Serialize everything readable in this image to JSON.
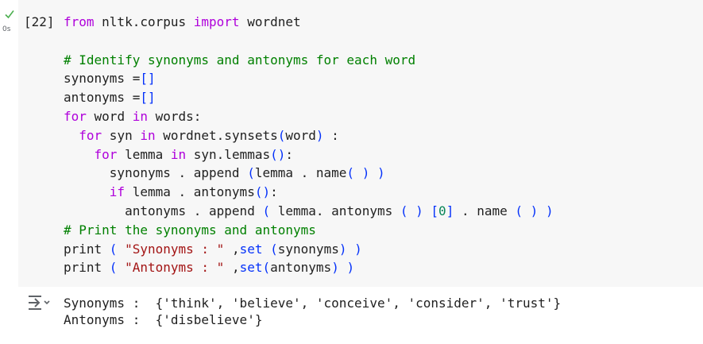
{
  "cell": {
    "execution_count": "[22]",
    "execution_time": "0s",
    "status": "success"
  },
  "code": {
    "line1": {
      "kw1": "from",
      "mod": " nltk.corpus ",
      "kw2": "import",
      "rest": " wordnet"
    },
    "line3": {
      "comment": "# Identify synonyms and antonyms for each word"
    },
    "line4": {
      "a": "synonyms =",
      "b": "[]"
    },
    "line5": {
      "a": "antonyms =",
      "b": "[]"
    },
    "line6": {
      "kw1": "for",
      "a": " word ",
      "kw2": "in",
      "b": " words:"
    },
    "line7": {
      "indent": "  ",
      "kw1": "for",
      "a": " syn ",
      "kw2": "in",
      "b": " wordnet.synsets",
      "p1": "(",
      "c": "word",
      "p2": ")",
      "d": " :"
    },
    "line8": {
      "indent": "    ",
      "kw1": "for",
      "a": " lemma ",
      "kw2": "in",
      "b": " syn.lemmas",
      "p1": "()",
      "c": ":"
    },
    "line9": {
      "indent": "      ",
      "a": "synonyms . append ",
      "p1": "(",
      "b": "lemma . name",
      "p2": "( )",
      "c": " ",
      "p3": ")"
    },
    "line10": {
      "indent": "      ",
      "kw1": "if",
      "a": " lemma . antonyms",
      "p1": "()",
      "b": ":"
    },
    "line11": {
      "indent": "        ",
      "a": "antonyms . append ",
      "p1": "(",
      "b": " lemma. antonyms ",
      "p2": "( )",
      "c": " ",
      "p3": "[",
      "n": "0",
      "p4": "]",
      "d": " . name ",
      "p5": "( )",
      "e": " ",
      "p6": ")"
    },
    "line12": {
      "comment": "# Print the synonyms and antonyms"
    },
    "line13": {
      "a": "print ",
      "p1": "(",
      "b": " ",
      "s": "\"Synonyms : \"",
      "c": " ,",
      "f": "set",
      "d": " ",
      "p2": "(",
      "e": "synonyms",
      "p3": ")",
      "g": " ",
      "p4": ")"
    },
    "line14": {
      "a": "print ",
      "p1": "(",
      "b": " ",
      "s": "\"Antonyms : \"",
      "c": " ,",
      "f": "set",
      "p2": "(",
      "e": "antonyms",
      "p3": ")",
      "g": " ",
      "p4": ")"
    }
  },
  "output": {
    "line1": "Synonyms :  {'think', 'believe', 'conceive', 'consider', 'trust'}",
    "line2": "Antonyms :  {'disbelieve'}"
  },
  "icons": {
    "check": "check-icon",
    "output": "output-toggle-icon"
  },
  "colors": {
    "check": "#4caf50",
    "keyword": "#af00db",
    "bracket": "#0431fa",
    "comment": "#008000",
    "string": "#a31515",
    "number": "#098658"
  }
}
